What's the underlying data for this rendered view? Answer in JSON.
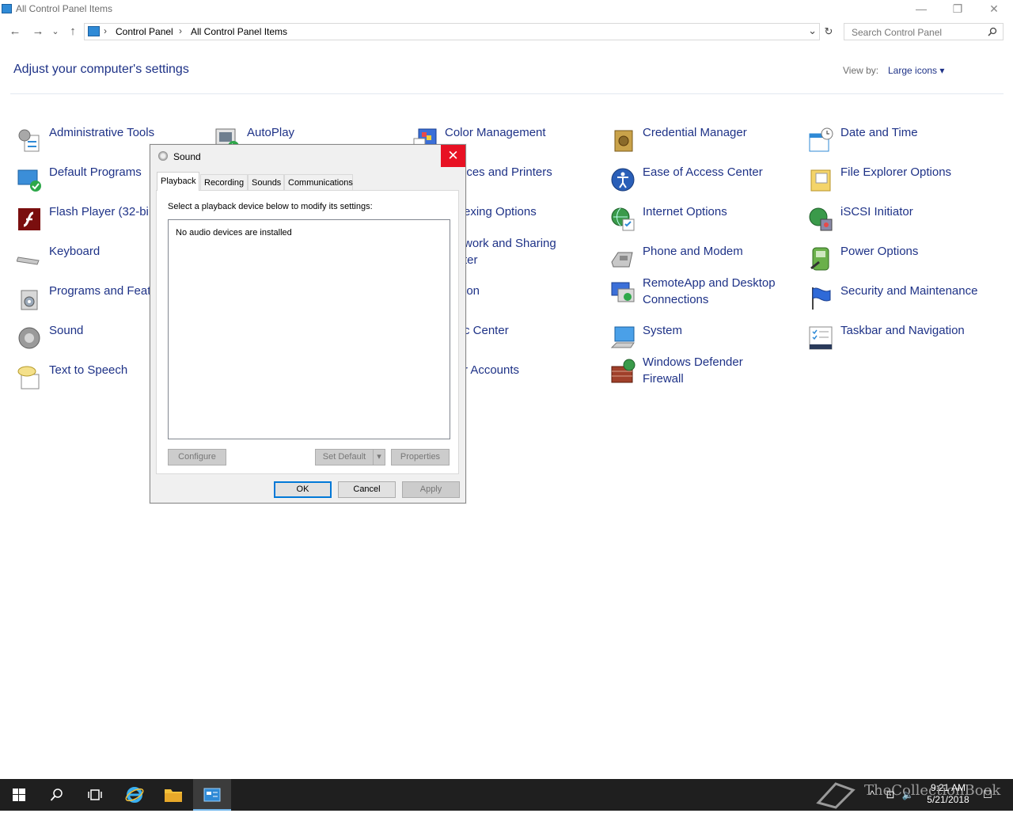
{
  "window": {
    "title": "All Control Panel Items",
    "minimize": "—",
    "restore": "❐",
    "close": "✕"
  },
  "nav": {
    "back": "←",
    "forward": "→",
    "recent": "⌄",
    "up": "↑",
    "breadcrumbs": [
      "Control Panel",
      "All Control Panel Items"
    ],
    "separator": "›",
    "dropdown": "⌄",
    "refresh": "↻",
    "search_placeholder": "Search Control Panel"
  },
  "header": {
    "title": "Adjust your computer's settings",
    "view_by_label": "View by:",
    "view_by_value": "Large icons ▾"
  },
  "items": {
    "col1": [
      "Administrative Tools",
      "Default Programs",
      "Flash Player (32-bi",
      "Keyboard",
      "Programs and Feat",
      "Sound",
      "Text to Speech"
    ],
    "col2": [
      "AutoPlay"
    ],
    "col3": [
      "Color Management",
      "ices and Printers",
      "exing Options",
      "work and Sharing",
      "ter",
      "ion",
      "c Center",
      "r Accounts"
    ],
    "col4": [
      "Credential Manager",
      "Ease of Access Center",
      "Internet Options",
      "Phone and Modem",
      "RemoteApp and Desktop",
      "Connections",
      "System",
      "Windows Defender",
      "Firewall"
    ],
    "col5": [
      "Date and Time",
      "File Explorer Options",
      "iSCSI Initiator",
      "Power Options",
      "Security and Maintenance",
      "Taskbar and Navigation"
    ]
  },
  "dialog": {
    "title": "Sound",
    "close": "✕",
    "tabs": [
      "Playback",
      "Recording",
      "Sounds",
      "Communications"
    ],
    "instruction": "Select a playback device below to modify its settings:",
    "empty_message": "No audio devices are installed",
    "configure": "Configure",
    "set_default": "Set Default",
    "set_default_arrow": "▾",
    "properties": "Properties",
    "ok": "OK",
    "cancel": "Cancel",
    "apply": "Apply"
  },
  "taskbar": {
    "start": "⊞",
    "search": "⚲",
    "taskview": "⧉",
    "ie": "e",
    "explorer": "▬",
    "controlpanel": "▣",
    "time": "9:21 AM",
    "date": "5/21/2018",
    "watermark": "TheCollectionBook",
    "tray_up": "^",
    "tray_net": "⊡",
    "tray_vol": "🔈",
    "tray_notif": "☐"
  },
  "colors": {
    "link": "#1e3287",
    "close_red": "#e81123",
    "taskbar": "#1f1f1f",
    "default_button": "#0078d7"
  }
}
